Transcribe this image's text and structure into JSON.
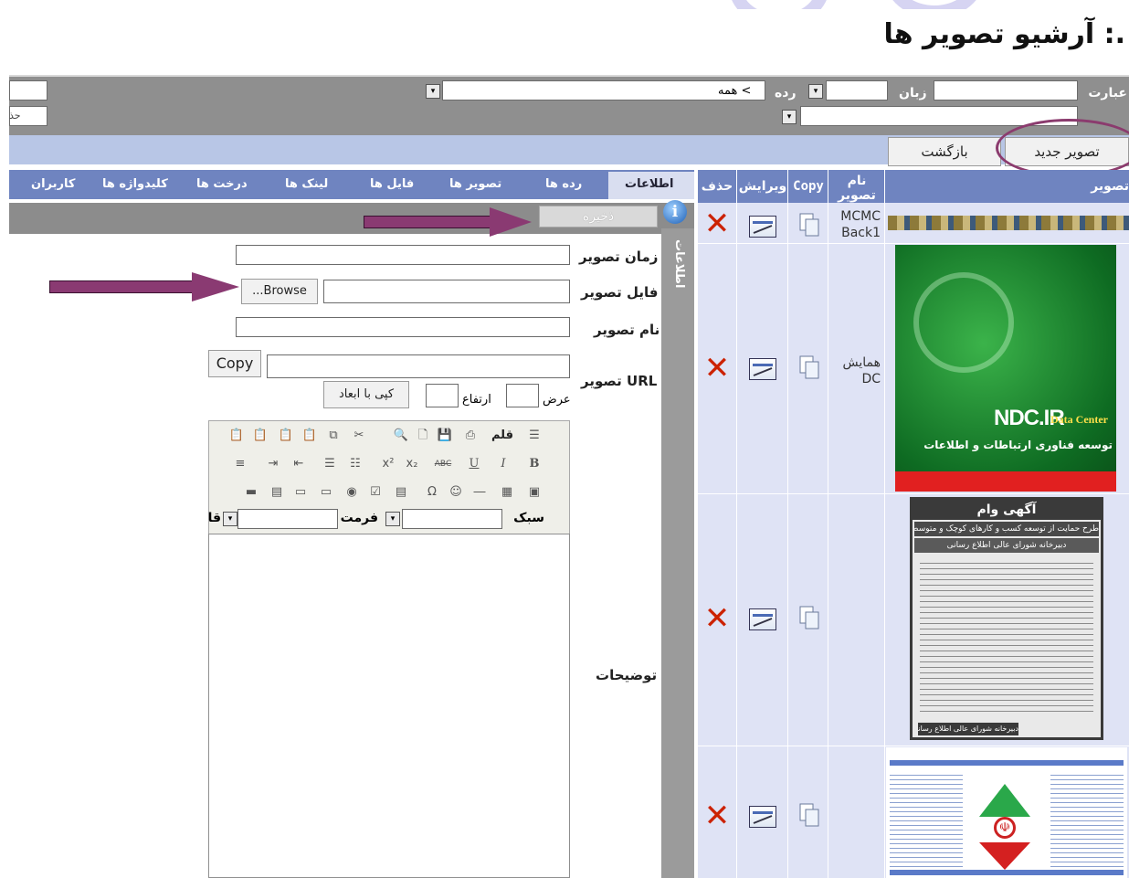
{
  "page": {
    "title": ".: آرشیو تصویر ها"
  },
  "filters": {
    "phrase_label": "عبارت",
    "language_label": "زبان",
    "category_label": "رده",
    "category_value": "> همه",
    "field2_label": "",
    "right_edge_label": "حذ",
    "dropdown_glyph": "▾"
  },
  "actions": {
    "new_image": "تصویر جدید",
    "back": "بازگشت"
  },
  "tabs": [
    "اطلاعات",
    "رده ها",
    "تصویر ها",
    "فایل ها",
    "لینک ها",
    "درخت ها",
    "کلیدواژه ها",
    "کاربران"
  ],
  "form": {
    "save": "ذخیره",
    "side_label": "اطلاعات",
    "info_icon_glyph": "i",
    "image_time_label": "زمان تصویر",
    "image_file_label": "فایل تصویر",
    "browse_button": "Browse...",
    "image_name_label": "نام تصویر",
    "url_label": "URL تصویر",
    "copy_button": "Copy",
    "width_label": "عرض",
    "height_label": "ارتفاع",
    "copy_dims_button": "کپی با ابعاد",
    "description_label": "توضیحات",
    "editor": {
      "style_label": "سبک",
      "format_label": "فرمت",
      "font_label": "قلم",
      "font_label_short": "قا",
      "bold": "B",
      "italic": "I",
      "underline": "U",
      "strike": "ABC",
      "subscript": "x₂",
      "superscript": "x²",
      "cut": "✂",
      "preview": "🔍",
      "newpage": "🗋",
      "save": "💾",
      "source": "☰"
    }
  },
  "table": {
    "headers": {
      "image": "تصویر",
      "name": "نام تصویر",
      "copy": "Copy",
      "edit": "ویرایش",
      "delete": "حذف"
    },
    "rows": [
      {
        "name": "MCMC Back1"
      },
      {
        "name": "همایش DC"
      },
      {
        "name": ""
      },
      {
        "name": ""
      }
    ],
    "thumbs": {
      "ndc_brand": "NDC.IR",
      "ndc_sub": "Data Center",
      "ndc_fa": "توسعه فناوری ارتباطات و اطلاعات",
      "ad_title": "آگهی وام",
      "ad_sub": "طرح حمایت از توسعه کسب و کارهای کوچک و متوسط ICT",
      "ad_sub2": "دبیرخانه شورای عالی اطلاع رسانی",
      "ad_footer": "دبیرخانه شورای عالی اطلاع رسانی"
    },
    "delete_glyph": "✕"
  },
  "colors": {
    "tabs": "#6f84c0",
    "filter_bar": "#8f8f8f",
    "annotation": "#8a3a72",
    "delete": "#cc2200"
  }
}
